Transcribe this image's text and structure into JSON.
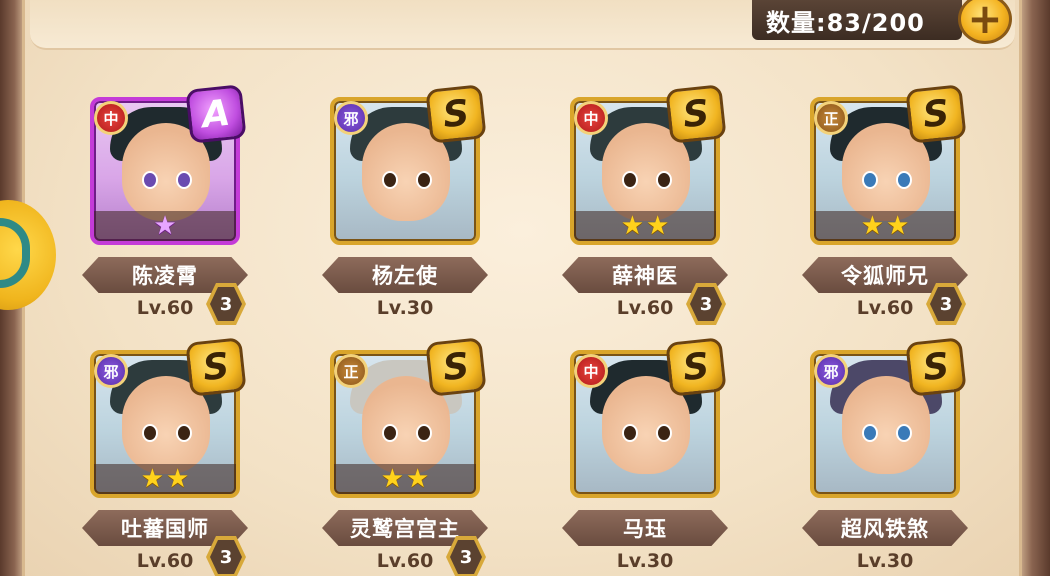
{
  "header": {
    "count_label": "数量:83/200",
    "add_icon": "plus-icon"
  },
  "colors": {
    "panel_bg": "#f3e2c6",
    "frame_gold": "#d9a52b",
    "frame_purple": "#c43bd8",
    "name_plate": "#7a5a4b",
    "faction_red": "#c42a24",
    "faction_purple": "#6a3fc4",
    "faction_brown": "#a86b28"
  },
  "heroes": [
    {
      "name": "陈凌霄",
      "level": "Lv.60",
      "faction": "中",
      "faction_color": "red",
      "rank": "A",
      "stars": 1,
      "star_color": "purple",
      "quality": "3"
    },
    {
      "name": "杨左使",
      "level": "Lv.30",
      "faction": "邪",
      "faction_color": "purple",
      "rank": "S",
      "stars": 0,
      "star_color": "gold",
      "quality": ""
    },
    {
      "name": "薛神医",
      "level": "Lv.60",
      "faction": "中",
      "faction_color": "red",
      "rank": "S",
      "stars": 2,
      "star_color": "gold",
      "quality": "3"
    },
    {
      "name": "令狐师兄",
      "level": "Lv.60",
      "faction": "正",
      "faction_color": "brown",
      "rank": "S",
      "stars": 2,
      "star_color": "gold",
      "quality": "3"
    },
    {
      "name": "吐蕃国师",
      "level": "Lv.60",
      "faction": "邪",
      "faction_color": "purple",
      "rank": "S",
      "stars": 2,
      "star_color": "gold",
      "quality": "3"
    },
    {
      "name": "灵鹫宫宫主",
      "level": "Lv.60",
      "faction": "正",
      "faction_color": "brown",
      "rank": "S",
      "stars": 2,
      "star_color": "gold",
      "quality": "3"
    },
    {
      "name": "马珏",
      "level": "Lv.30",
      "faction": "中",
      "faction_color": "red",
      "rank": "S",
      "stars": 0,
      "star_color": "gold",
      "quality": ""
    },
    {
      "name": "超风铁煞",
      "level": "Lv.30",
      "faction": "邪",
      "faction_color": "purple",
      "rank": "S",
      "stars": 0,
      "star_color": "gold",
      "quality": ""
    }
  ]
}
